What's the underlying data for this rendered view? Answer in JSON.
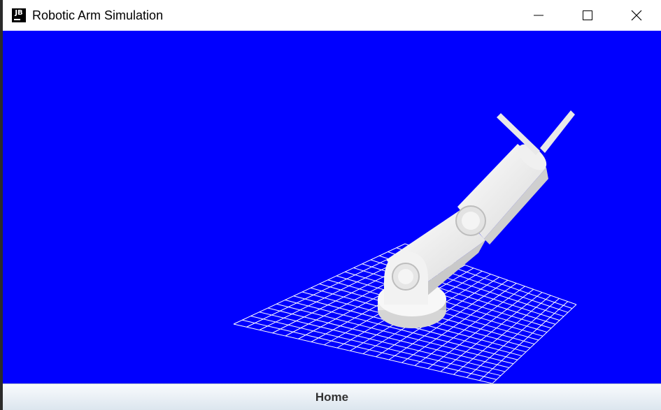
{
  "window": {
    "title": "Robotic Arm Simulation",
    "app_icon": "jb-icon",
    "controls": [
      "minimize-icon",
      "maximize-icon",
      "close-icon"
    ]
  },
  "scene": {
    "background_color": "#0000ff",
    "grid_color": "#ffffff",
    "arm_color": "#f0f0f0"
  },
  "footer": {
    "home_label": "Home"
  }
}
